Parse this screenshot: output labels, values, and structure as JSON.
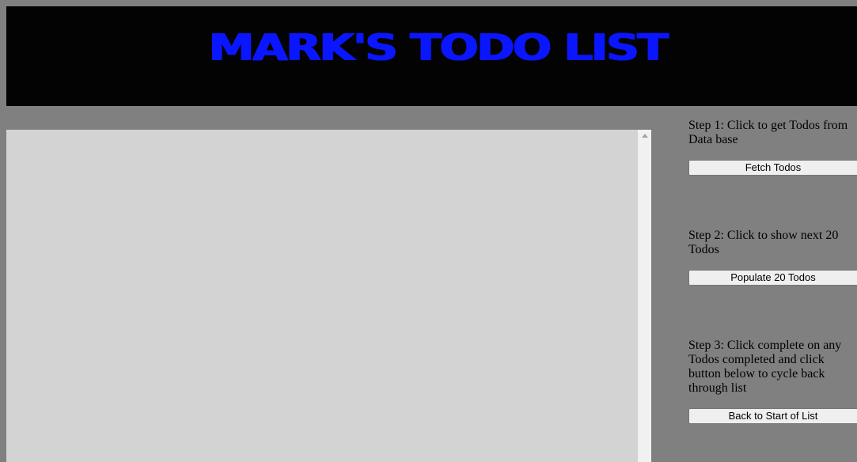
{
  "header": {
    "title": "MARK'S TODO LIST"
  },
  "steps": [
    {
      "text": "Step 1: Click to get Todos from Data base",
      "button_label": "Fetch Todos"
    },
    {
      "text": "Step 2: Click to show next 20 Todos",
      "button_label": "Populate 20 Todos"
    },
    {
      "text": "Step 3: Click complete on any Todos completed and click button below to cycle back through list",
      "button_label": "Back to Start of List"
    }
  ],
  "todo_list": {
    "items": []
  },
  "colors": {
    "page_background": "#808080",
    "header_background": "#030303",
    "title_color": "#0a16ff",
    "list_background": "#d3d3d3"
  }
}
